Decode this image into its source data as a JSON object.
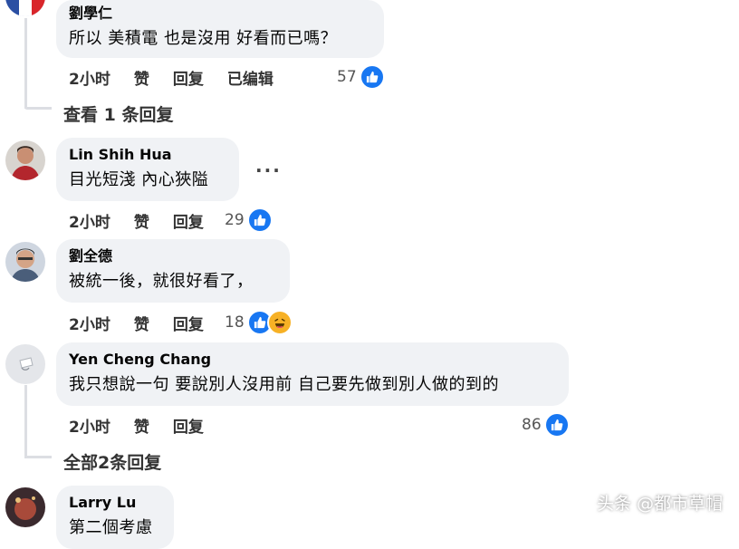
{
  "colors": {
    "bubble_bg": "#f0f2f5",
    "like_blue": "#1877f2",
    "haha_yellow": "#f7b125"
  },
  "comments": [
    {
      "name": "劉學仁",
      "text": "所以 美積電 也是沒用 好看而已嗎？",
      "time": "2小时",
      "like": "赞",
      "reply": "回复",
      "edited": "已编辑",
      "count": "57",
      "reactions": [
        "like-icon"
      ]
    },
    {
      "name": "Lin Shih Hua",
      "text": "目光短淺 內心狹隘",
      "time": "2小时",
      "like": "赞",
      "reply": "回复",
      "count": "29",
      "reactions": [
        "like-icon"
      ]
    },
    {
      "name": "劉全德",
      "text": "被統一後，就很好看了，",
      "time": "2小时",
      "like": "赞",
      "reply": "回复",
      "count": "18",
      "reactions": [
        "like-icon",
        "haha-icon"
      ]
    },
    {
      "name": "Yen Cheng Chang",
      "text": "我只想說一句 要說別人沒用前 自己要先做到別人做的到的",
      "time": "2小时",
      "like": "赞",
      "reply": "回复",
      "count": "86",
      "reactions": [
        "like-icon"
      ]
    },
    {
      "name": "Larry Lu",
      "text": "第二個考慮"
    }
  ],
  "view_replies_1": "查看 1 条回复",
  "view_replies_2": "全部2条回复",
  "more_label": "···",
  "watermark": "头条 @都市草帽"
}
